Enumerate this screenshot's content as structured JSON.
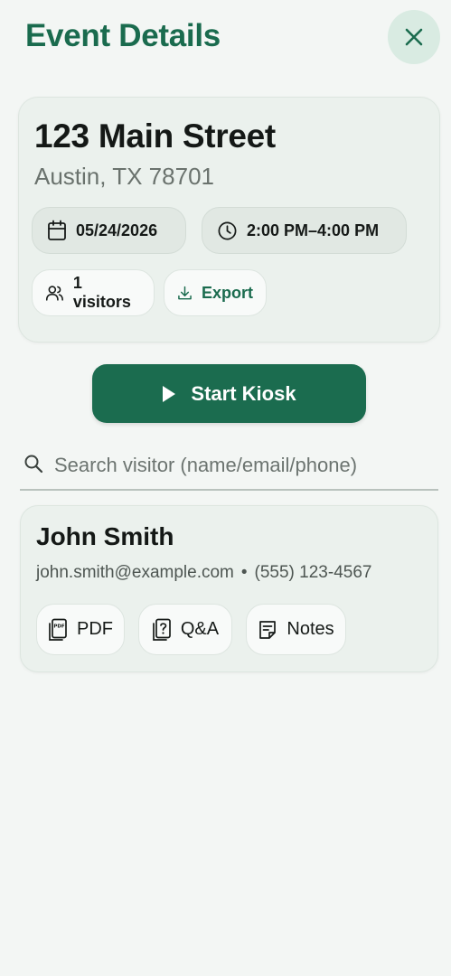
{
  "header": {
    "title": "Event Details",
    "close_icon": "close-icon"
  },
  "event": {
    "address": "123 Main Street",
    "city": "Austin, TX 78701",
    "date": "05/24/2026",
    "time": "2:00 PM–4:00 PM",
    "visitors": "1 visitors",
    "export_label": "Export",
    "icons": {
      "date": "calendar-icon",
      "time": "clock-icon",
      "visitors": "users-icon",
      "export": "download-icon"
    }
  },
  "kiosk": {
    "label": "Start Kiosk",
    "icon": "play-icon"
  },
  "search": {
    "placeholder": "Search visitor (name/email/phone)",
    "value": "",
    "icon": "search-icon"
  },
  "visitors": [
    {
      "name": "John Smith",
      "email": "john.smith@example.com",
      "separator": "•",
      "phone": "(555) 123-4567",
      "actions": [
        {
          "label": "PDF",
          "icon": "pdf-file-icon"
        },
        {
          "label": "Q&A",
          "icon": "question-doc-icon"
        },
        {
          "label": "Notes",
          "icon": "notes-icon"
        }
      ]
    }
  ],
  "colors": {
    "accent": "#1b6c4f",
    "background": "#f3f6f4",
    "card": "#ebf1ed",
    "close_bg": "#d9ebe2"
  }
}
